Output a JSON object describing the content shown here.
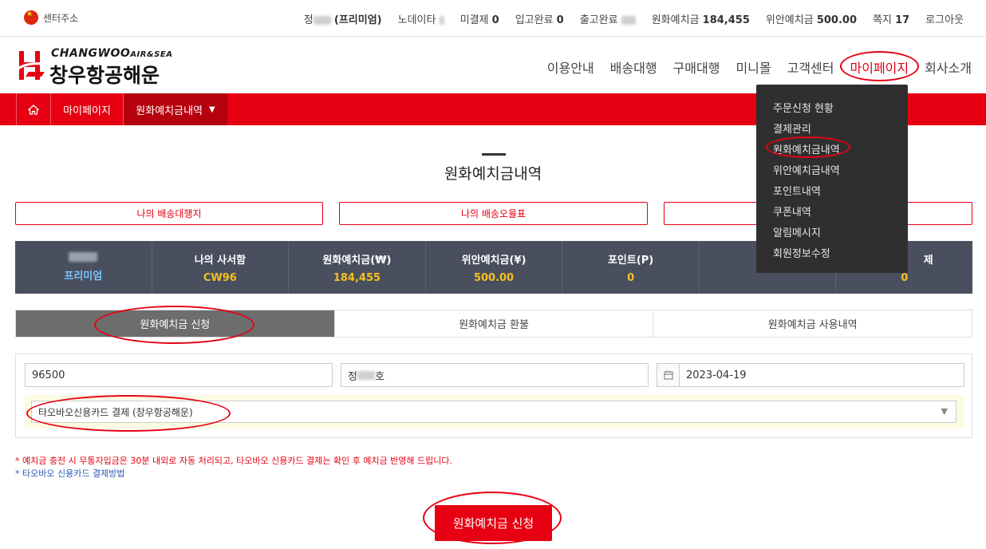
{
  "topbar": {
    "center_address": "센터주소",
    "user_suffix": "(프리미엄)",
    "nodata_label": "노데이타",
    "unpaid_label": "미결제",
    "unpaid_count": "0",
    "received_label": "입고완료",
    "received_count": "0",
    "shipped_label": "출고완료",
    "krw_label": "원화예치금",
    "krw_value": "184,455",
    "cny_label": "위안예치금",
    "cny_value": "500.00",
    "msg_label": "쪽지",
    "msg_count": "17",
    "logout": "로그아웃"
  },
  "logo": {
    "en": "CHANGWOO",
    "en_sub": "AIR&SEA",
    "ko": "창우항공해운"
  },
  "nav": [
    "이용안내",
    "배송대행",
    "구매대행",
    "미니몰",
    "고객센터",
    "마이페이지",
    "회사소개"
  ],
  "breadcrumb": {
    "mypage": "마이페이지",
    "current": "원화예치금내역"
  },
  "page_title": "원화예치금내역",
  "quick_buttons": [
    "나의 배송대행지",
    "나의 배송오율표",
    ""
  ],
  "stats": [
    {
      "label": "",
      "value": "프리미엄"
    },
    {
      "label": "나의 사서함",
      "value": "CW96"
    },
    {
      "label": "원화예치금(₩)",
      "value": "184,455"
    },
    {
      "label": "위안예치금(¥)",
      "value": "500.00"
    },
    {
      "label": "포인트(P)",
      "value": "0"
    },
    {
      "label": "",
      "value": "0"
    },
    {
      "label": "제",
      "value": "0"
    }
  ],
  "tabs": [
    "원화예치금 신청",
    "원화예치금 환불",
    "원화예치금 사용내역"
  ],
  "form": {
    "amount": "96500",
    "depositor_prefix": "정",
    "depositor_suffix": "호",
    "date": "2023-04-19",
    "payment_method": "타오바오신용카드 결제 (창우항공해운)"
  },
  "notes": {
    "line1": "* 예치금 충전 시 무통자입금은 30분 내외로 자동 처리되고, 타오바오 신용카드 결제는 확인 후 예치금 반영해 드립니다.",
    "line2": "* 타오바오 신용카드 결제방법"
  },
  "submit_label": "원화예치금 신청",
  "dropdown": [
    "주문신청 현황",
    "결제관리",
    "원화예치금내역",
    "위안예치금내역",
    "포인트내역",
    "쿠폰내역",
    "알림메시지",
    "회원정보수정"
  ],
  "colors": {
    "brand_red": "#e60012",
    "stats_bg": "#4a4f5f",
    "stat_value": "#f4c21d",
    "dropdown_bg": "#2f2f2f"
  }
}
